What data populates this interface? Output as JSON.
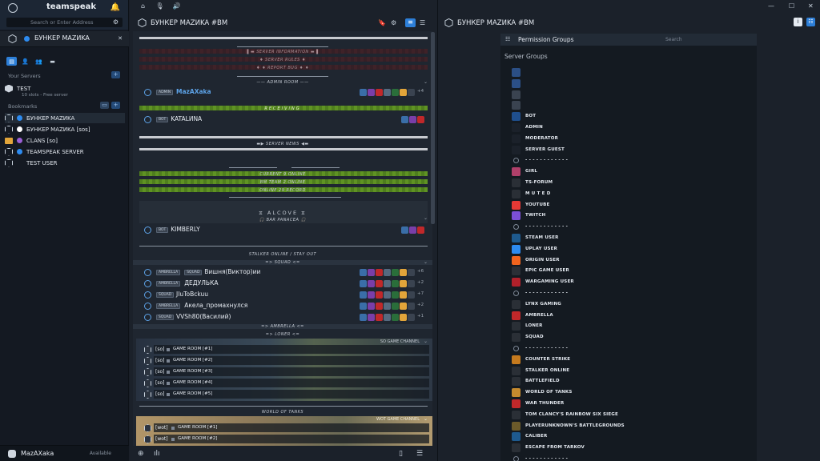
{
  "sidebar": {
    "brand": "teamspeak",
    "search_placeholder": "Search or Enter Address",
    "tab_name": "БУНКЕР MAZИKA",
    "your_servers_label": "Your Servers",
    "bookmarks_label": "Bookmarks",
    "server": {
      "name": "TEST",
      "sub": "10 slots - Free server"
    },
    "bookmarks": [
      {
        "label": "БУНКЕР MAZИKA",
        "color": "#2d8bf0",
        "icon": "hexagon-icon"
      },
      {
        "label": "БУНКЕР MAZИKA [sos]",
        "color": "#ffffff",
        "icon": "hexagon-icon"
      },
      {
        "label": "CLANS [so]",
        "color": "#9b5fd6",
        "icon": "folder-icon"
      },
      {
        "label": "TEAMSPEAK SERVER",
        "color": "#2d8bf0",
        "icon": "hexagon-icon"
      },
      {
        "label": "TEST USER",
        "color": "",
        "icon": "hexagon-icon"
      }
    ],
    "user": {
      "name": "MazAXaka",
      "status": "Available"
    }
  },
  "middle": {
    "title": "БУНКЕР MAZИKA #BM",
    "channels": {
      "server_information": "SERVER INFORMATION",
      "server_rules": "SERVER RULES",
      "report_bug": "REPORT BUG",
      "admin_room": "ADMIN ROOM",
      "receiving": "RECEIVING",
      "server_news": "SERVER NEWS",
      "current_online": "CURRENT 9 ONLINE",
      "bm_team_online": "BM TEAM 2 ONLINE",
      "online_record": "ONLINE 29 RECORD",
      "alcove": "ALCOVE",
      "bar_panacea": "BAR PANACEA",
      "stalker": "STALKER ONLINE / STAY OUT",
      "squad": "SQUAD",
      "ambrella": "AMBRELLA",
      "loner": "LONER",
      "so_game_channel": "SO GAME CHANNEL",
      "world_of_tanks": "WORLD OF TANKS",
      "wot_game_channel": "WOT GAME CHANNEL"
    },
    "clients": [
      {
        "tag1": "ADMIN",
        "tag2": "",
        "name": "MazAXaka",
        "count": "+4",
        "highlight": true
      },
      {
        "tag1": "BOT",
        "tag2": "",
        "name": "KATALИNA",
        "count": "",
        "highlight": false
      },
      {
        "tag1": "BOT",
        "tag2": "",
        "name": "KIMBERLY",
        "count": "",
        "highlight": false
      }
    ],
    "squad_members": [
      {
        "tag1": "AMBRELLA",
        "tag2": "SQUAD",
        "name": "Вишня(Виктор)ии",
        "count": "+6"
      },
      {
        "tag1": "AMBRELLA",
        "tag2": "",
        "name": "ДЕДУЛЬКА",
        "count": "+2"
      },
      {
        "tag1": "SQUAD",
        "tag2": "",
        "name": "JIuToBckuu",
        "count": "+7"
      },
      {
        "tag1": "AMBRELLA",
        "tag2": "",
        "name": "Акела_промахнулся",
        "count": "+2"
      },
      {
        "tag1": "SQUAD",
        "tag2": "",
        "name": "VVSh80(Василий)",
        "count": "+1"
      }
    ],
    "game_rooms_so": [
      {
        "tag": "[so]",
        "name": "GAME ROOM [#1]"
      },
      {
        "tag": "[so]",
        "name": "GAME ROOM [#2]"
      },
      {
        "tag": "[so]",
        "name": "GAME ROOM [#3]"
      },
      {
        "tag": "[so]",
        "name": "GAME ROOM [#4]"
      },
      {
        "tag": "[so]",
        "name": "GAME ROOM [#5]"
      }
    ],
    "game_rooms_wot": [
      {
        "tag": "[wot]",
        "name": "GAME ROOM [#1]"
      },
      {
        "tag": "[wot]",
        "name": "GAME ROOM [#2]"
      }
    ]
  },
  "right": {
    "title": "БУНКЕР MAZИKA #BM",
    "panel_title": "Permission Groups",
    "search_placeholder": "Search",
    "section": "Server Groups",
    "groups": [
      {
        "name": "",
        "icon": "server-icon",
        "color": "#2b4f86"
      },
      {
        "name": "",
        "icon": "server-icon",
        "color": "#2b4f86"
      },
      {
        "name": "",
        "icon": "server-icon",
        "color": "#3a4350"
      },
      {
        "name": "",
        "icon": "server-icon",
        "color": "#3a4350"
      },
      {
        "name": "BOT",
        "icon": "bot-icon",
        "color": "#1f4f8e"
      },
      {
        "name": "ADMIN",
        "icon": "admin-icon",
        "color": "#1b212a"
      },
      {
        "name": "MODERATOR",
        "icon": "moderator-icon",
        "color": "#1b212a"
      },
      {
        "name": "SERVER GUEST",
        "icon": "guest-icon",
        "color": "#1b212a"
      },
      {
        "name": "- - - - - - - - - - - -",
        "icon": "divider-icon",
        "color": "#141a21"
      },
      {
        "name": "GIRL",
        "icon": "girl-icon",
        "color": "#b0406a"
      },
      {
        "name": "TS-FORUM",
        "icon": "forum-icon",
        "color": "#2a2f36"
      },
      {
        "name": "M U T E D",
        "icon": "muted-icon",
        "color": "#2a2f36"
      },
      {
        "name": "YOUTUBE",
        "icon": "youtube-icon",
        "color": "#e53935"
      },
      {
        "name": "TWITCH",
        "icon": "twitch-icon",
        "color": "#7b4fd6"
      },
      {
        "name": "- - - - - - - - - - - -",
        "icon": "divider-icon",
        "color": "#141a21"
      },
      {
        "name": "STEAM USER",
        "icon": "steam-icon",
        "color": "#1e5a8e"
      },
      {
        "name": "UPLAY USER",
        "icon": "uplay-icon",
        "color": "#2d8bf0"
      },
      {
        "name": "ORIGIN USER",
        "icon": "origin-icon",
        "color": "#f0641e"
      },
      {
        "name": "EPIC GAME USER",
        "icon": "epic-icon",
        "color": "#2a2f36"
      },
      {
        "name": "WARGAMING USER",
        "icon": "wargaming-icon",
        "color": "#b0202a"
      },
      {
        "name": "- - - - - - - - - - - -",
        "icon": "divider-icon",
        "color": "#141a21"
      },
      {
        "name": "LYNX GAMING",
        "icon": "lynx-icon",
        "color": "#2a2f36"
      },
      {
        "name": "AMBRELLA",
        "icon": "umbrella-icon",
        "color": "#c0282a"
      },
      {
        "name": "LONER",
        "icon": "loner-icon",
        "color": "#2a2f36"
      },
      {
        "name": "SQUAD",
        "icon": "squad-icon",
        "color": "#2a2f36"
      },
      {
        "name": "- - - - - - - - - - - -",
        "icon": "divider-icon",
        "color": "#141a21"
      },
      {
        "name": "COUNTER STRIKE",
        "icon": "cs-icon",
        "color": "#c57a1e"
      },
      {
        "name": "STALKER ONLINE",
        "icon": "stalker-icon",
        "color": "#2a2f36"
      },
      {
        "name": "BATTLEFIELD",
        "icon": "battlefield-icon",
        "color": "#2a2f36"
      },
      {
        "name": "WORLD OF TANKS",
        "icon": "wot-icon",
        "color": "#c58a2e"
      },
      {
        "name": "WAR THUNDER",
        "icon": "warthunder-icon",
        "color": "#c0282a"
      },
      {
        "name": "TOM CLANCY'S RAINBOW SIX SIEGE",
        "icon": "r6-icon",
        "color": "#2a2f36"
      },
      {
        "name": "PLAYERUNKNOWN'S BATTLEGROUNDS",
        "icon": "pubg-icon",
        "color": "#6b5a2a"
      },
      {
        "name": "CALIBER",
        "icon": "caliber-icon",
        "color": "#1e5a8e"
      },
      {
        "name": "ESCAPE FROM TARKOV",
        "icon": "tarkov-icon",
        "color": "#2a2f36"
      },
      {
        "name": "- - - - - - - - - - - -",
        "icon": "divider-icon",
        "color": "#141a21"
      }
    ]
  }
}
